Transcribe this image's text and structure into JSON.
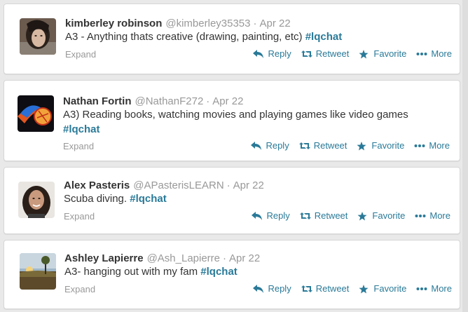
{
  "tweets": [
    {
      "name": "kimberley robinson",
      "handle": "@kimberley35353",
      "separator": "·",
      "date": "Apr 22",
      "text": "A3 - Anything thats creative (drawing, painting, etc) ",
      "hashtag": "#lqchat",
      "expand": "Expand",
      "avatar": "avatar-woman-dark-hair"
    },
    {
      "name": "Nathan Fortin",
      "handle": "@NathanF272",
      "separator": "·",
      "date": "Apr 22",
      "text": "A3) Reading books, watching movies and playing games like video games\n",
      "hashtag": "#lqchat",
      "expand": "Expand",
      "avatar": "avatar-flaming-ball"
    },
    {
      "name": "Alex Pasteris",
      "handle": "@APasterisLEARN",
      "separator": "·",
      "date": "Apr 22",
      "text": "Scuba diving. ",
      "hashtag": "#lqchat",
      "expand": "Expand",
      "avatar": "avatar-woman-portrait"
    },
    {
      "name": "Ashley Lapierre",
      "handle": "@Ash_Lapierre",
      "separator": "·",
      "date": "Apr 22",
      "text": "A3- hanging out with my fam ",
      "hashtag": "#lqchat",
      "expand": "Expand",
      "avatar": "avatar-landscape-sunset"
    }
  ],
  "actions": {
    "reply": "Reply",
    "retweet": "Retweet",
    "favorite": "Favorite",
    "more": "More"
  },
  "colors": {
    "link": "#2a7a98",
    "muted": "#999999",
    "text": "#333333"
  }
}
